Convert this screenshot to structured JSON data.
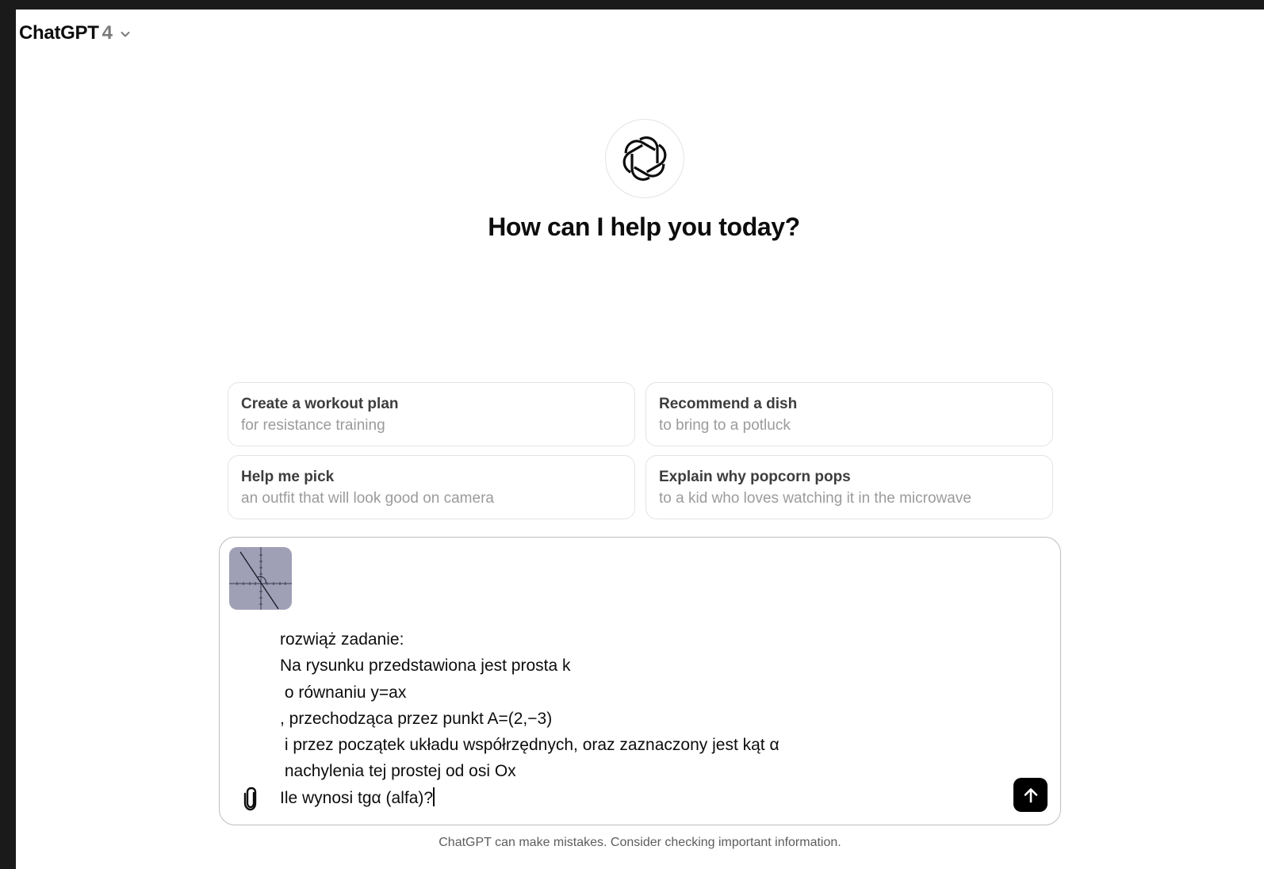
{
  "header": {
    "model_name": "ChatGPT",
    "model_version": "4",
    "chevron_icon": "chevron-down-icon"
  },
  "hero": {
    "logo_icon": "openai-logo-icon",
    "headline": "How can I help you today?"
  },
  "suggestions": [
    {
      "title": "Create a workout plan",
      "subtitle": "for resistance training"
    },
    {
      "title": "Recommend a dish",
      "subtitle": "to bring to a potluck"
    },
    {
      "title": "Help me pick",
      "subtitle": "an outfit that will look good on camera"
    },
    {
      "title": "Explain why popcorn pops",
      "subtitle": "to a kid who loves watching it in the microwave"
    }
  ],
  "composer": {
    "attachment_icon": "image-thumbnail-graph",
    "prompt_lines": [
      "rozwiąż zadanie:",
      "Na rysunku przedstawiona jest prosta k",
      " o równaniu y=ax",
      ", przechodząca przez punkt A=(2,−3)",
      " i przez początek układu współrzędnych, oraz zaznaczony jest kąt α",
      " nachylenia tej prostej od osi Ox",
      "Ile wynosi tgα (alfa)?"
    ],
    "attach_icon": "paperclip-icon",
    "send_icon": "arrow-up-icon"
  },
  "footer": {
    "disclaimer": "ChatGPT can make mistakes. Consider checking important information."
  },
  "colors": {
    "page_bg": "#ffffff",
    "frame_bg": "#1a1a1a",
    "send_button": "#000000",
    "thumbnail_bg": "#9fa0b6"
  }
}
